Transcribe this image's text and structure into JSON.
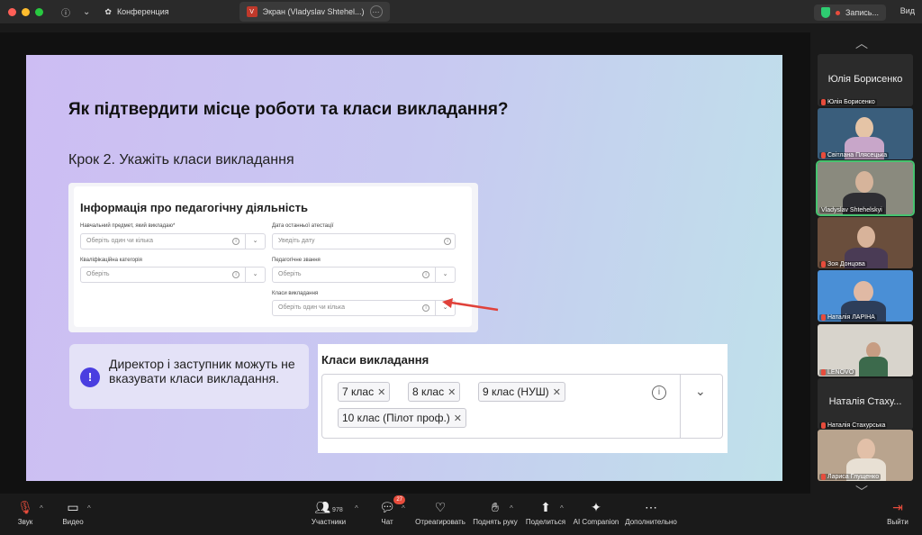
{
  "topbar": {
    "meeting_title": "Конференция",
    "share_tab": "Экран (Vladyslav Shtehel...)",
    "share_badge": "V",
    "record_label": "Запись...",
    "view_label": "Вид"
  },
  "slide": {
    "title": "Як підтвердити місце роботи та класи викладання?",
    "step": "Крок 2. Укажіть класи викладання",
    "form": {
      "heading": "Інформація про педагогічну діяльність",
      "subject_label": "Навчальний предмет, який викладаю*",
      "subject_placeholder": "Оберіть один чи кілька",
      "attestation_label": "Дата останньої атестації",
      "attestation_placeholder": "Уведіть дату",
      "category_label": "Кваліфікаційна категорія",
      "category_placeholder": "Оберіть",
      "rank_label": "Педагогічне звання",
      "rank_placeholder": "Оберіть",
      "classes_label": "Класи викладання",
      "classes_placeholder": "Оберіть один чи кілька"
    },
    "note": {
      "icon": "!",
      "text": "Директор і заступник можуть не вказувати класи викладання."
    },
    "classes": {
      "heading": "Класи викладання",
      "chips": [
        "7 клас",
        "8 клас",
        "9 клас (НУШ)",
        "10 клас (Пілот проф.)"
      ]
    }
  },
  "side": {
    "tiles": [
      {
        "big": "Юлія Борисенко",
        "label": "Юлія Борисенко"
      },
      {
        "label": "Світлана Плясецька"
      },
      {
        "label": "Vladyslav Shtehelskyi"
      },
      {
        "label": "Зоя Донцова"
      },
      {
        "label": "Наталія ЛАРІНА"
      },
      {
        "label": "LENOVO"
      },
      {
        "big": "Наталія Стаху...",
        "label": "Наталія Стахурська"
      },
      {
        "label": "Лариса Глущенко"
      }
    ]
  },
  "toolbar": {
    "audio": "Звук",
    "video": "Видео",
    "participants": "Участники",
    "participants_count": "978",
    "chat": "Чат",
    "chat_badge": "27",
    "react": "Отреагировать",
    "raise_hand": "Поднять руку",
    "share": "Поделиться",
    "ai": "AI Companion",
    "more": "Дополнительно",
    "leave": "Выйти"
  },
  "colors": {
    "accent": "#4a3ee0",
    "active_speaker": "#46c36f",
    "leave": "#e74c3c"
  }
}
